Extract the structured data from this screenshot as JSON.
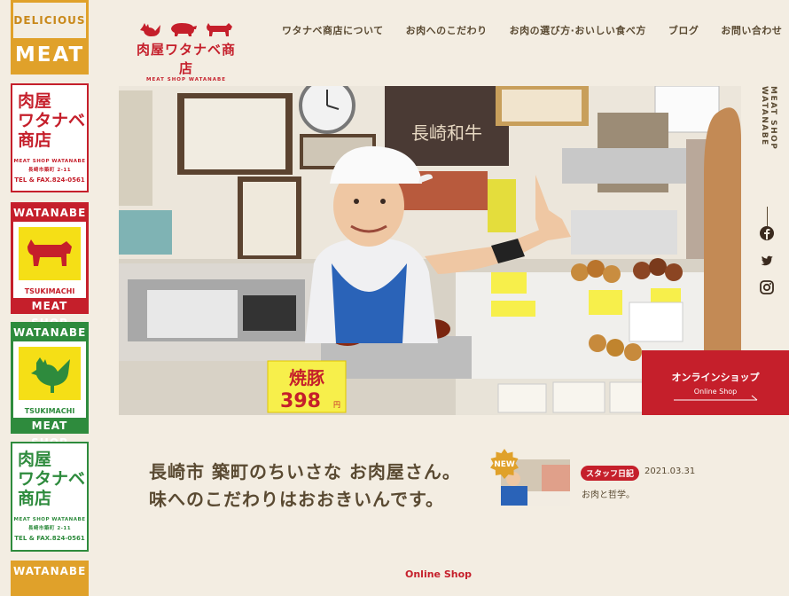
{
  "rail": {
    "delicious_meat": {
      "top": "DELICIOUS",
      "bottom": "MEAT"
    },
    "shop_card_red": {
      "kanji": [
        "肉屋",
        "ワタナベ",
        "商店"
      ],
      "small": "MEAT SHOP WATANABE",
      "address": "長崎市築町 2-11",
      "tel": "TEL & FAX.824-0561"
    },
    "watanabe_cow": {
      "header": "WATANABE",
      "town": "TSUKIMACHI",
      "footer": "MEAT SHOP"
    },
    "watanabe_rooster": {
      "header": "WATANABE",
      "town": "TSUKIMACHI",
      "footer": "MEAT SHOP"
    },
    "shop_card_green": {
      "kanji": [
        "肉屋",
        "ワタナベ",
        "商店"
      ],
      "small": "MEAT SHOP WATANABE",
      "address": "長崎市築町 2-11",
      "tel": "TEL & FAX.824-0561"
    },
    "watanabe_partial": {
      "header": "WATANABE"
    }
  },
  "logo": {
    "name": "肉屋ワタナベ商店",
    "sub": "MEAT SHOP WATANABE"
  },
  "nav": [
    {
      "label": "ワタナベ商店について"
    },
    {
      "label": "お肉へのこだわり"
    },
    {
      "label": "お肉の選び方·おいしい食べ方"
    },
    {
      "label": "ブログ"
    },
    {
      "label": "お問い合わせ"
    }
  ],
  "hero": {
    "sign_price": "398",
    "sign_item": "焼豚",
    "sign_price_unit": "円",
    "store_sign": "長崎和牛"
  },
  "online_shop": {
    "label_jp": "オンラインショップ",
    "label_en": "Online Shop"
  },
  "side": {
    "vertical_text": "MEAT SHOP WATANABE",
    "social_icons": [
      "facebook-icon",
      "twitter-icon",
      "instagram-icon"
    ]
  },
  "headline": {
    "line1": "長崎市 築町のちいさな お肉屋さん。",
    "line2": "味へのこだわりはおおきいんです。"
  },
  "news": {
    "new_label": "NEW",
    "category": "スタッフ日記",
    "date": "2021.03.31",
    "title": "お肉と哲学。"
  },
  "section_label": "Online Shop",
  "colors": {
    "brand_red": "#c51f2b",
    "green": "#2e8b3d",
    "mustard": "#e0a12a",
    "background": "#f3ede2",
    "text": "#5a4a32"
  }
}
